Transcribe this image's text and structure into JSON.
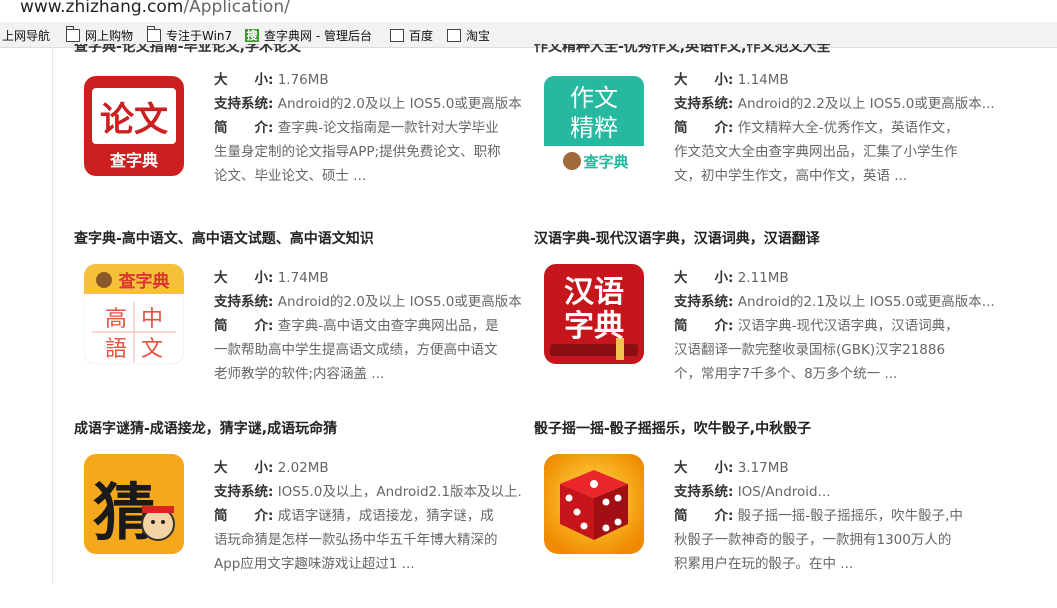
{
  "browser": {
    "url_host": "www.zhizhang.com",
    "url_path": "/Application/",
    "bookmarks": [
      {
        "label": "上网导航",
        "icon": "none"
      },
      {
        "label": "网上购物",
        "icon": "folder"
      },
      {
        "label": "专注于Win7",
        "icon": "folder"
      },
      {
        "label": "查字典网 - 管理后台",
        "icon": "sou"
      },
      {
        "label": "百度",
        "icon": "page"
      },
      {
        "label": "淘宝",
        "icon": "page"
      }
    ],
    "sou_glyph": "搜"
  },
  "cut_titles": [
    "查字典-论文指南-毕业论文,学术论文",
    "作文精粹大全-优秀作文,英语作文,作文范文大全"
  ],
  "labels": {
    "size": "大　　小:",
    "system": "支持系统:",
    "intro": "简　　介:"
  },
  "apps": [
    {
      "title": "",
      "size": "1.76MB",
      "system": "Android的2.0及以上 IOS5.0或更高版本",
      "intro": "查字典-论文指南是一款针对大学毕业生量身定制的论文指导APP;提供免费论文、职称论文、毕业论文、硕士 ...",
      "icon_text": [
        "论文",
        "查字典"
      ],
      "icon_name": "lunwen-app-icon"
    },
    {
      "title": "",
      "size": "1.14MB",
      "system": "Android的2.2及以上 IOS5.0或更高版本...",
      "intro": "作文精粹大全-优秀作文，英语作文，作文范文大全由查字典网出品，汇集了小学生作文，初中学生作文，高中作文，英语 ...",
      "icon_text": [
        "作文",
        "精粹",
        "查字典"
      ],
      "icon_name": "zuowen-app-icon"
    },
    {
      "title": "查字典-高中语文、高中语文试题、高中语文知识",
      "size": "1.74MB",
      "system": "Android的2.0及以上 IOS5.0或更高版本",
      "intro": "查字典-高中语文由查字典网出品，是一款帮助高中学生提高语文成绩，方便高中语文老师教学的软件;内容涵盖 ...",
      "icon_text": [
        "查字典",
        "高",
        "中",
        "語",
        "文"
      ],
      "icon_name": "gaozhong-yuwen-app-icon"
    },
    {
      "title": "汉语字典-现代汉语字典，汉语词典，汉语翻译",
      "size": "2.11MB",
      "system": "Android的2.1及以上 IOS5.0或更高版本...",
      "intro": "汉语字典-现代汉语字典，汉语词典，汉语翻译一款完整收录国标(GBK)汉字21886个，常用字7千多个、8万多个统一 ...",
      "icon_text": [
        "汉语",
        "字典"
      ],
      "icon_name": "hanyu-zidian-app-icon"
    },
    {
      "title": "成语字谜猜-成语接龙，猜字谜,成语玩命猜",
      "size": "2.02MB",
      "system": "IOS5.0及以上，Android2.1版本及以上.",
      "intro": "成语字谜猜，成语接龙，猜字谜，成语玩命猜是怎样一款弘扬中华五千年博大精深的App应用文字趣味游戏让超过1 ...",
      "icon_text": [
        "猜"
      ],
      "icon_name": "chengyu-cai-app-icon"
    },
    {
      "title": "骰子摇一摇-骰子摇摇乐，吹牛骰子,中秋骰子",
      "size": "3.17MB",
      "system": "IOS/Android...",
      "intro": "骰子摇一摇-骰子摇摇乐，吹牛骰子,中秋骰子一款神奇的骰子，一款拥有1300万人的积累用户在玩的骰子。在中 ...",
      "icon_text": [],
      "icon_name": "dice-app-icon"
    }
  ]
}
